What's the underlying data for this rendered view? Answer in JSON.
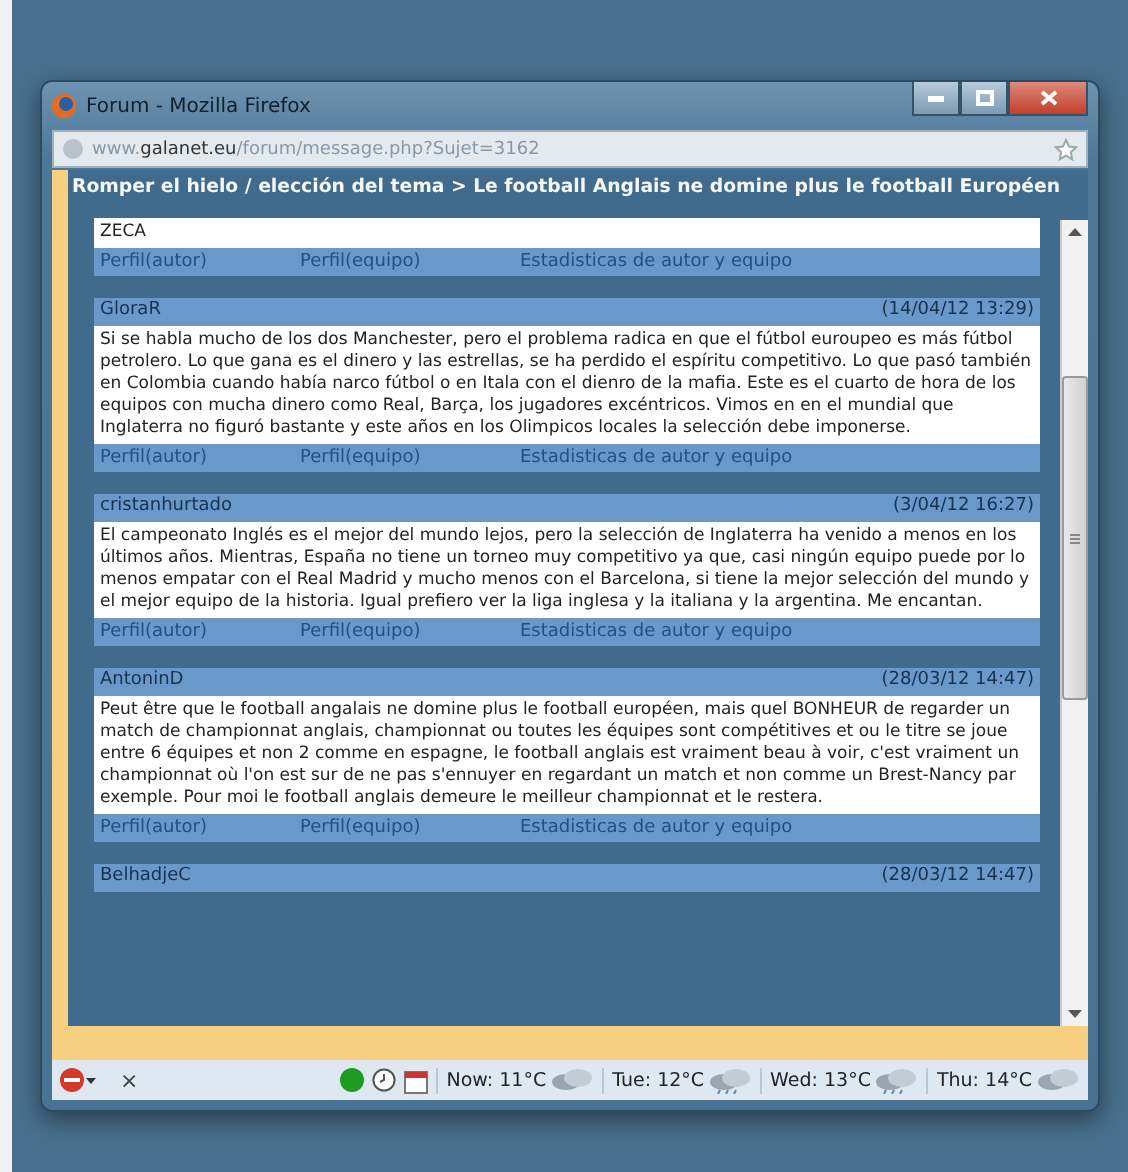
{
  "window": {
    "title": "Forum - Mozilla Firefox"
  },
  "address_bar": {
    "prefix": "www.",
    "domain": "galanet.eu",
    "path": "/forum/message.php?Sujet=3162"
  },
  "breadcrumb": "Romper el hielo / elección del tema > Le football Anglais ne domine plus le football Européen",
  "posts": [
    {
      "body": "ZECA",
      "links": [
        "Perfil(autor)",
        "Perfil(equipo)",
        "Estadisticas de autor y equipo"
      ]
    },
    {
      "author": "GloraR",
      "date": "(14/04/12 13:29)",
      "body": "Si se habla mucho de los dos Manchester, pero el problema radica en que el fútbol euroupeo es más fútbol petrolero. Lo que gana es el dinero y las estrellas, se ha perdido el espíritu competitivo. Lo que pasó también en Colombia cuando había narco fútbol o en Itala con el dienro de la mafia. Este es el cuarto de hora de los equipos con mucha dinero como Real, Barça, los jugadores excéntricos. Vimos en en el mundial que Inglaterra no figuró bastante y este años en los Olimpicos locales la selección debe imponerse.",
      "links": [
        "Perfil(autor)",
        "Perfil(equipo)",
        "Estadisticas de autor y equipo"
      ]
    },
    {
      "author": "cristanhurtado",
      "date": "(3/04/12 16:27)",
      "body": "El campeonato Inglés es el mejor del mundo lejos, pero la selección de Inglaterra ha venido a menos en los últimos años. Mientras, España no tiene un torneo muy competitivo ya que, casi ningún equipo puede por lo menos empatar con el Real Madrid y mucho menos con el Barcelona, si tiene la mejor selección del mundo y el mejor equipo de la historia. Igual prefiero ver la liga inglesa y la italiana y la argentina. Me encantan.",
      "links": [
        "Perfil(autor)",
        "Perfil(equipo)",
        "Estadisticas de autor y equipo"
      ]
    },
    {
      "author": "AntoninD",
      "date": "(28/03/12 14:47)",
      "body": "Peut être que le football angalais ne domine plus le football européen, mais quel BONHEUR de regarder un match de championnat anglais, championnat ou toutes les équipes sont compétitives et ou le titre se joue entre 6 équipes et non 2 comme en espagne, le football anglais est vraiment beau à voir, c'est vraiment un championnat où l'on est sur de ne pas s'ennuyer en regardant un match et non comme un Brest-Nancy par exemple. Pour moi le football anglais demeure le meilleur championnat et le restera.",
      "links": [
        "Perfil(autor)",
        "Perfil(equipo)",
        "Estadisticas de autor y equipo"
      ]
    },
    {
      "author": "BelhadjeC",
      "date": "(28/03/12 14:47)"
    }
  ],
  "status_bar": {
    "close": "×",
    "weather": [
      {
        "label": "Now: 11°C",
        "kind": "cloudy"
      },
      {
        "label": "Tue: 12°C",
        "kind": "rain"
      },
      {
        "label": "Wed: 13°C",
        "kind": "rain"
      },
      {
        "label": "Thu: 14°C",
        "kind": "cloudy"
      }
    ]
  }
}
